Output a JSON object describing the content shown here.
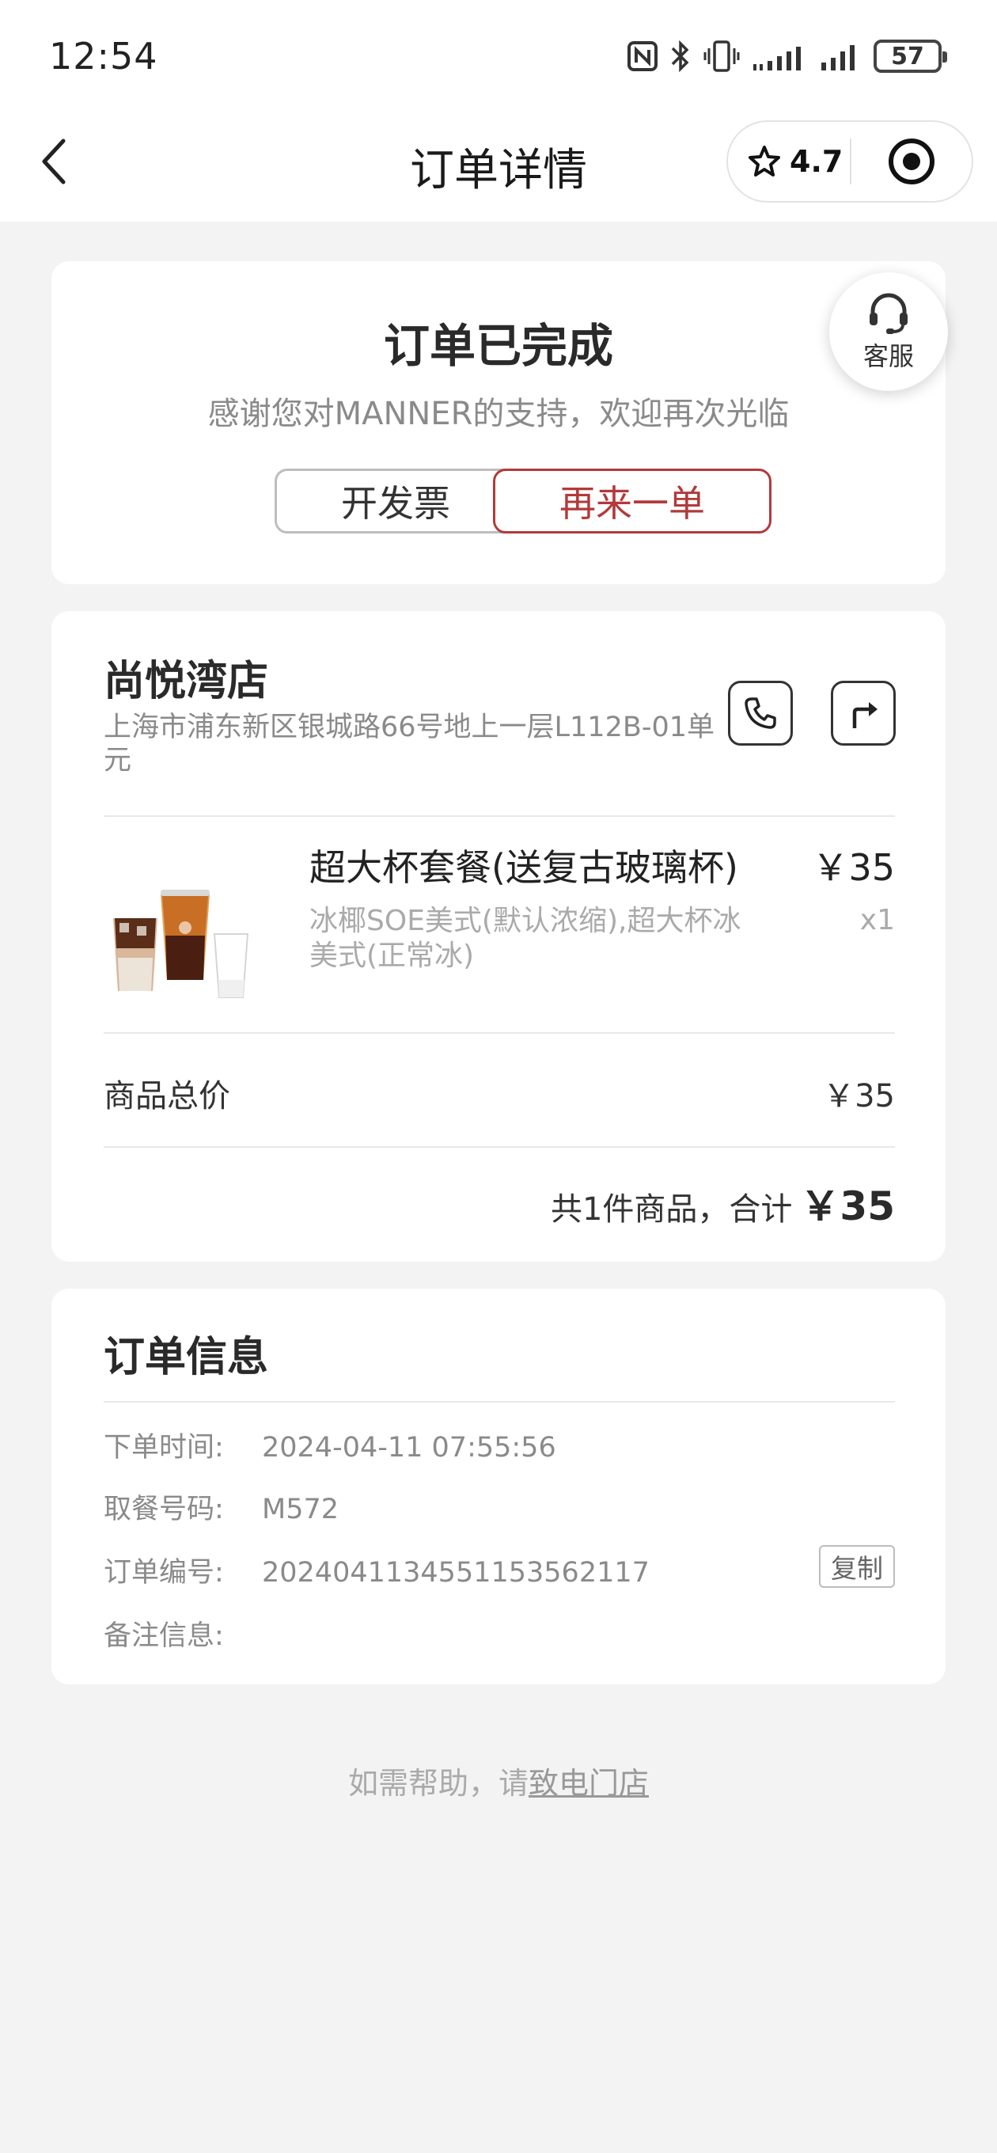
{
  "status_bar": {
    "time": "12:54",
    "battery": "57"
  },
  "nav": {
    "title": "订单详情",
    "rating": "4.7"
  },
  "order_status": {
    "title": "订单已完成",
    "subtitle": "感谢您对MANNER的支持，欢迎再次光临",
    "invoice_label": "开发票",
    "reorder_label": "再来一单"
  },
  "customer_service": {
    "label": "客服"
  },
  "store": {
    "name": "尚悦湾店",
    "address": "上海市浦东新区银城路66号地上一层L112B-01单元"
  },
  "items": [
    {
      "name": "超大杯套餐(送复古玻璃杯)",
      "price": "￥35",
      "spec": "冰椰SOE美式(默认浓缩),超大杯冰美式(正常冰)",
      "qty": "x1"
    }
  ],
  "totals": {
    "goods_total_label": "商品总价",
    "goods_total_value": "￥35",
    "summary_text": "共1件商品，合计",
    "summary_value": "￥35"
  },
  "order_info": {
    "title": "订单信息",
    "rows": [
      {
        "label": "下单时间:",
        "value": "2024-04-11 07:55:56"
      },
      {
        "label": "取餐号码:",
        "value": "M572"
      },
      {
        "label": "订单编号:",
        "value": "20240411345511535621​17"
      },
      {
        "label": "备注信息:",
        "value": ""
      }
    ],
    "copy_label": "复制"
  },
  "help": {
    "prefix": "如需帮助，请",
    "link": "致电门店"
  },
  "colors": {
    "accent": "#b23a3a",
    "background": "#f3f3f3"
  }
}
